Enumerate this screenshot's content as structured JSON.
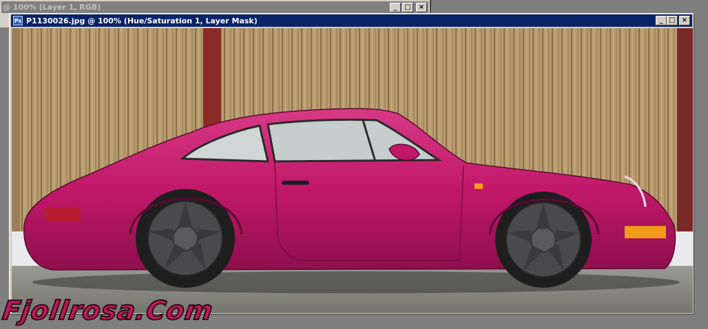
{
  "background_window": {
    "title": "@ 100% (Layer 1, RGB)"
  },
  "document_window": {
    "title": "P1130026.jpg @ 100% (Hue/Saturation 1, Layer Mask)",
    "app_icon": "photoshop-document-icon",
    "controls": {
      "minimize": "_",
      "maximize": "□",
      "close": "×"
    }
  },
  "image": {
    "subject_color": "#c2186a",
    "fence_color": "#b59a6e"
  },
  "watermark": {
    "text": "Fjollrosa.Com",
    "color": "#c2185b"
  }
}
